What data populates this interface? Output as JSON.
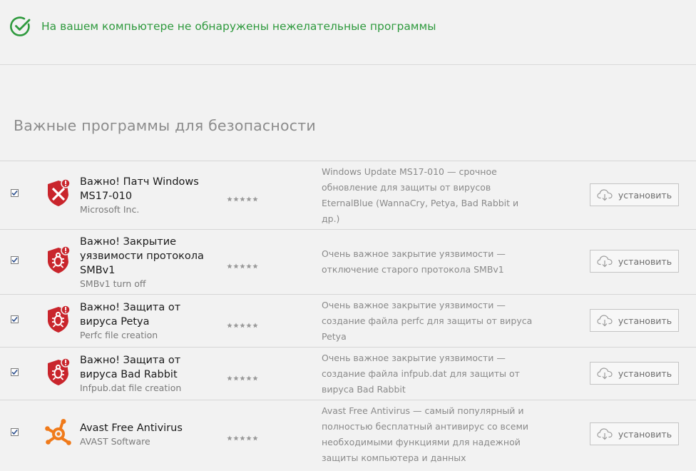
{
  "status": {
    "text": "На вашем компьютере не обнаружены нежелательные программы",
    "icon": "check-circle-icon",
    "color": "#2f9a3e"
  },
  "section": {
    "title": "Важные программы для безопасности"
  },
  "items": [
    {
      "checked": true,
      "icon": "shield-alert-icon",
      "name": "Важно! Патч Windows MS17-010",
      "vendor": "Microsoft Inc.",
      "rating": 5,
      "description": "Windows Update MS17-010 — срочное обновление для защиты от вирусов EternalBlue (WannaCry, Petya, Bad Rabbit и др.)",
      "button_label": "установить"
    },
    {
      "checked": true,
      "icon": "shield-bug-icon",
      "name": "Важно! Закрытие уязвимости протокола SMBv1",
      "vendor": "SMBv1 turn off",
      "rating": 5,
      "description": "Очень важное закрытие уязвимости — отключение старого протокола SMBv1",
      "button_label": "установить"
    },
    {
      "checked": true,
      "icon": "shield-bug-icon",
      "name": "Важно! Защита от вируса Petya",
      "vendor": "Perfc file creation",
      "rating": 5,
      "description": "Очень важное закрытие уязвимости — создание файла perfc для защиты от вируса Petya",
      "button_label": "установить"
    },
    {
      "checked": true,
      "icon": "shield-bug-icon",
      "name": "Важно! Защита от вируса Bad Rabbit",
      "vendor": "Infpub.dat file creation",
      "rating": 5,
      "description": "Очень важное закрытие уязвимости — создание файла infpub.dat для защиты от вируса Bad Rabbit",
      "button_label": "установить"
    },
    {
      "checked": true,
      "icon": "avast-logo-icon",
      "name": "Avast Free Antivirus",
      "vendor": "AVAST Software",
      "rating": 5,
      "description": "Avast Free Antivirus — самый популярный и полностью бесплатный антивирус со всеми необходимыми функциями для надежной защиты компьютера и данных",
      "button_label": "установить"
    }
  ],
  "colors": {
    "accent_green": "#2f9a3e",
    "shield_red": "#c9252c",
    "avast_orange": "#f07a1a"
  }
}
